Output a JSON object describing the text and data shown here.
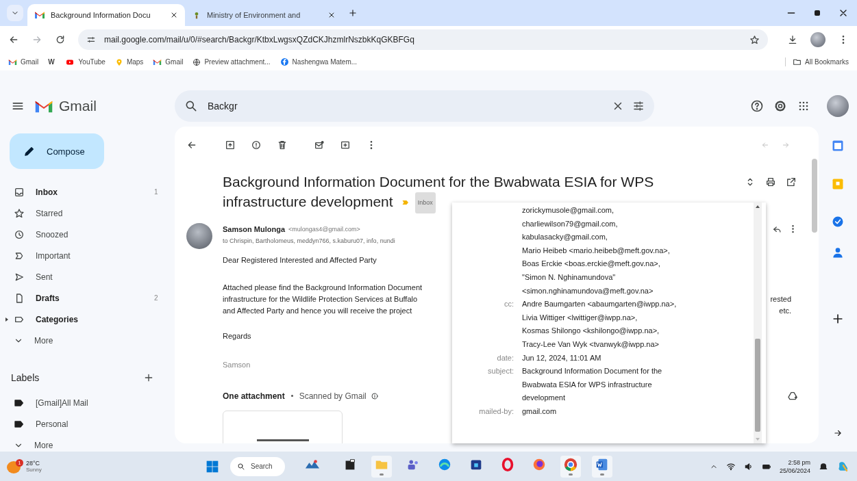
{
  "browser": {
    "tabs": [
      {
        "title": "Background Information Docu",
        "kind": "mail",
        "selected": true
      },
      {
        "title": "Ministry of Environment and",
        "kind": "emblem",
        "selected": false
      }
    ],
    "url": "mail.google.com/mail/u/0/#search/Backgr/KtbxLwgsxQZdCKJhzmlrNszbkKqGKBFGq",
    "bookmarks": [
      {
        "kind": "mail",
        "label": "Gmail"
      },
      {
        "kind": "text",
        "label": "W"
      },
      {
        "kind": "video",
        "label": "YouTube"
      },
      {
        "kind": "pin",
        "label": "Maps"
      },
      {
        "kind": "mail",
        "label": "Gmail"
      },
      {
        "kind": "globe",
        "label": "Preview attachment..."
      },
      {
        "kind": "social",
        "label": "Nashengwa Matem..."
      }
    ],
    "all_bookmarks": "All Bookmarks"
  },
  "gmail": {
    "product": "Gmail",
    "search": {
      "value": "Backgr"
    },
    "compose": "Compose",
    "nav": [
      {
        "kind": "inbox",
        "label": "Inbox",
        "count": "1",
        "bold": true
      },
      {
        "kind": "star",
        "label": "Starred",
        "bold": false
      },
      {
        "kind": "clock",
        "label": "Snoozed",
        "bold": false
      },
      {
        "kind": "important",
        "label": "Important",
        "bold": false
      },
      {
        "kind": "sent",
        "label": "Sent",
        "bold": false
      },
      {
        "kind": "draft",
        "label": "Drafts",
        "count": "2",
        "bold": true
      },
      {
        "kind": "category",
        "label": "Categories",
        "bold": true
      },
      {
        "kind": "more",
        "label": "More",
        "bold": false
      }
    ],
    "labels_heading": "Labels",
    "labels": [
      {
        "kind": "label",
        "label": "[Gmail]All Mail"
      },
      {
        "kind": "label",
        "label": "Personal"
      },
      {
        "kind": "more",
        "label": "More"
      }
    ]
  },
  "message": {
    "subject": "Background Information Document for the Bwabwata ESIA for WPS infrastructure development",
    "important": true,
    "label_chip": "Inbox",
    "sender_name": "Samson Mulonga",
    "sender_email": "<mulongas4@gmail.com>",
    "to_line": "to Chrispin, Bartholomeus, meddyn766, s.kaburu07, info, nundi",
    "greeting": "Dear Registered Interested and Affected Party",
    "body_lines": [
      {
        "left": "Attached please find the Background Information Document"
      },
      {
        "left": "infrastructure for the Wildlife Protection Services at Buffalo",
        "right": "rested"
      },
      {
        "left": "and Affected Party and hence you will receive the project",
        "right": "etc."
      }
    ],
    "closing": "Regards",
    "signature": "Samson",
    "attachment_count": "One attachment",
    "scan_note": "Scanned by Gmail"
  },
  "details": [
    {
      "values": [
        "zorickymusole@gmail.com,",
        "charliewilson79@gmail.com,",
        "kabulasacky@gmail.com,",
        "Mario Heibeb <mario.heibeb@meft.gov.na>,",
        "Boas Erckie <boas.erckie@meft.gov.na>,",
        "\"Simon N. Nghinamundova\"",
        "<simon.nghinamundova@meft.gov.na>"
      ]
    },
    {
      "label": "cc:",
      "values": [
        "Andre Baumgarten <abaumgarten@iwpp.na>,",
        "Livia Wittiger <lwittiger@iwpp.na>,",
        "Kosmas Shilongo <kshilongo@iwpp.na>,",
        "Tracy-Lee Van Wyk <tvanwyk@iwpp.na>"
      ]
    },
    {
      "label": "date:",
      "values": [
        "Jun 12, 2024, 11:01 AM"
      ]
    },
    {
      "label": "subject:",
      "values": [
        "Background Information Document for the Bwabwata ESIA for WPS infrastructure development"
      ]
    },
    {
      "label": "mailed-by:",
      "values": [
        "gmail.com"
      ]
    }
  ],
  "taskbar": {
    "weather": {
      "temp": "28°C",
      "condition": "Sunny",
      "badge": "1"
    },
    "search": "Search",
    "apps": [
      {
        "kind": "landscape",
        "running": false
      },
      {
        "kind": "terminal",
        "running": false
      },
      {
        "kind": "folder",
        "running": true
      },
      {
        "kind": "people",
        "running": false
      },
      {
        "kind": "wave",
        "running": false
      },
      {
        "kind": "store",
        "running": false
      },
      {
        "kind": "ring",
        "running": false
      },
      {
        "kind": "fox",
        "running": false
      },
      {
        "kind": "chrome",
        "running": true
      },
      {
        "kind": "doc",
        "running": true
      }
    ],
    "time": "2:58 pm",
    "date": "25/06/2024"
  }
}
